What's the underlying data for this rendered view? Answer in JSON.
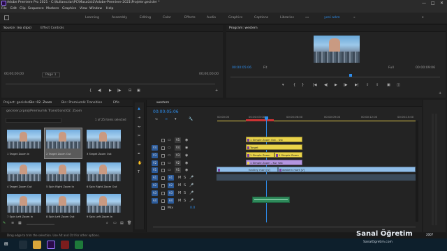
{
  "window": {
    "title": "Adobe Premiere Pro 2021 - C:\\Kullanıcılar\\PC\\Masaüstü\\Adobe-Premiere-2021\\Projeler.gecisler *",
    "controls": [
      "—",
      "□",
      "✕"
    ]
  },
  "menu": [
    "File",
    "Edit",
    "Clip",
    "Sequence",
    "Markers",
    "Graphics",
    "View",
    "Window",
    "Help"
  ],
  "workspaces": [
    "Learning",
    "Assembly",
    "Editing",
    "Color",
    "Effects",
    "Audio",
    "Graphics",
    "Captions",
    "Libraries",
    "»»",
    "yeni adım",
    "»"
  ],
  "source_panel": {
    "tabs": [
      "Source: (no clips)",
      "Effect Controls"
    ],
    "tc_left": "00;00;00;00",
    "page": "Page 1",
    "tc_right": "00;00;00;00"
  },
  "program_panel": {
    "title": "Program: western",
    "tc": "00:00:05:06",
    "fit": "Fit",
    "full": "Full",
    "duration": "00:00:09:06"
  },
  "project_panel": {
    "tabs": [
      "Project: gecisler",
      "Bin: 02. Zoom",
      "Bin: Premiumlk Transition",
      "Effe"
    ],
    "path": "gecisler.prproj\\Premiumlk Transitions\\02. Zoom",
    "count": "1 of 25 items selected",
    "items": [
      {
        "name": "1 Target Zoom In",
        "dur": "1;00"
      },
      {
        "name": "2 Target Zoom Out",
        "dur": "1;00"
      },
      {
        "name": "3 Target Zoom Out",
        "dur": "1;00"
      },
      {
        "name": "4 Target Zoom Out",
        "dur": "1;00"
      },
      {
        "name": "5 Spin Right Zoom In",
        "dur": "1;00"
      },
      {
        "name": "6 Spin Right Zoom Out",
        "dur": "1;00"
      },
      {
        "name": "7 Spin Left Zoom In",
        "dur": "1;00"
      },
      {
        "name": "8 Spin Left Zoom Out",
        "dur": "1;00"
      },
      {
        "name": "9 Spin Left Zoom In",
        "dur": "1;00"
      }
    ]
  },
  "timeline": {
    "tab": "western",
    "tc": "00:00:05:06",
    "ruler": [
      "00:00:00",
      "00:00:03:00",
      "00:00:06:00",
      "00:00:09:00",
      "00:00:12:00",
      "00:00:15:00"
    ],
    "tracks": [
      "V5",
      "V4",
      "V3",
      "V2",
      "V1",
      "A1",
      "A2",
      "A3",
      "A4"
    ],
    "master": "Mix",
    "master_val": "0.0",
    "clips": {
      "v5": "1 Simple Zoom Out - Ust",
      "v4": "Target",
      "v3a": "1 Simple Zoom",
      "v3b": "1 Simple Zoom",
      "v2": "1 Simple Zoom - Kur Vak",
      "v1a": "fonkley mart [V]",
      "v1b": "western mart [V]"
    },
    "colors": {
      "yellow": "#e9d34a",
      "purple": "#b395e0",
      "blue": "#8fbde8",
      "green": "#2f8a5b"
    }
  },
  "status": "Drag edge to trim the selection. Use Alt and Ctrl for other options.",
  "watermark": {
    "brand": "Sanal Öğretim",
    "year": "2007",
    "site": "SanalOgretim.com"
  }
}
